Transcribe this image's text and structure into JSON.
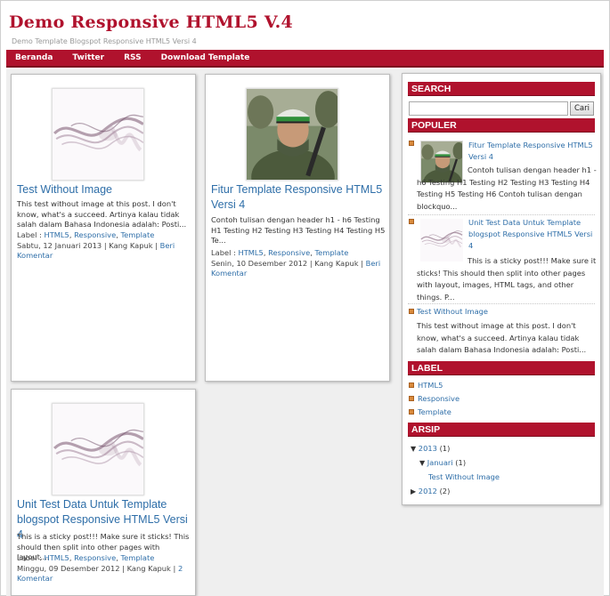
{
  "blog": {
    "title": "Demo Responsive HTML5 V.4",
    "description": "Demo Template Blogspot Responsive HTML5 Versi 4"
  },
  "nav": {
    "items": [
      "Beranda",
      "Twitter",
      "RSS",
      "Download Template"
    ]
  },
  "posts": [
    {
      "title": "Test Without Image",
      "snippet": "This test without image at this post. I don't know, what's a succeed. Artinya kalau tidak salah dalam Bahasa Indonesia adalah: Posti...",
      "label_prefix": "Label :",
      "labels": [
        "HTML5",
        "Responsive",
        "Template"
      ],
      "date": "Sabtu, 12 Januari 2013",
      "author": "Kang Kapuk",
      "comment": "Beri Komentar",
      "thumb": "smoke-image"
    },
    {
      "title": "Fitur Template Responsive HTML5 Versi 4",
      "snippet": "Contoh tulisan dengan header h1 - h6 Testing H1 Testing H2 Testing H3 Testing H4 Testing H5 Te...",
      "label_prefix": "Label :",
      "labels": [
        "HTML5",
        "Responsive",
        "Template"
      ],
      "date": "Senin, 10 Desember 2012",
      "author": "Kang Kapuk",
      "comment": "Beri Komentar",
      "thumb": "soldier-photo"
    },
    {
      "title": "Unit Test Data Untuk Template blogspot Responsive HTML5 Versi 4",
      "snippet": "This is a sticky post!!! Make sure it sticks! This should then split into other pages with layout,...",
      "label_prefix": "Label :",
      "labels": [
        "HTML5",
        "Responsive",
        "Template"
      ],
      "date": "Minggu, 09 Desember 2012",
      "author": "Kang Kapuk",
      "comment": "2 Komentar",
      "thumb": "smoke-image"
    }
  ],
  "sidebar": {
    "search": {
      "heading": "SEARCH",
      "button": "Cari",
      "value": ""
    },
    "popular": {
      "heading": "POPULER",
      "items": [
        {
          "title": "Fitur Template Responsive HTML5 Versi 4",
          "text": "Contoh tulisan dengan header h1 - h6 Testing H1 Testing H2 Testing H3 Testing H4 Testing H5 Testing H6 Contoh tulisan dengan blockquo...",
          "thumb": "soldier-photo"
        },
        {
          "title": "Unit Test Data Untuk Template blogspot Responsive HTML5 Versi 4",
          "text": "This is a sticky post!!! Make sure it sticks! This should then split into other pages with layout, images, HTML tags, and other things. P...",
          "thumb": "smoke-image"
        },
        {
          "title": "Test Without Image",
          "text": "This test without image at this post. I don't know, what's a succeed. Artinya kalau tidak salah dalam Bahasa Indonesia adalah: Posti..."
        }
      ]
    },
    "label": {
      "heading": "LABEL",
      "items": [
        "HTML5",
        "Responsive",
        "Template"
      ]
    },
    "archive": {
      "heading": "ARSIP",
      "year1": "2013",
      "year1_count": "(1)",
      "month1": "Januari",
      "month1_count": "(1)",
      "post1": "Test Without Image",
      "year2": "2012",
      "year2_count": "(2)"
    }
  },
  "colors": {
    "accent": "#b0122d",
    "link": "#2e6ea8",
    "background": "#efefef"
  }
}
